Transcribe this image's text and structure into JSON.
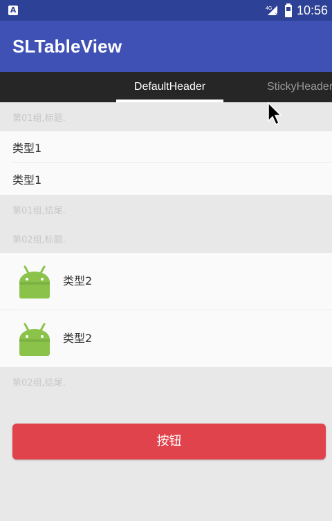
{
  "status_bar": {
    "network_label": "4G",
    "time": "10:56"
  },
  "app_bar": {
    "title": "SLTableView"
  },
  "tabs": [
    {
      "label": "DefaultHeader",
      "selected": true
    },
    {
      "label": "StickyHeader",
      "selected": false
    }
  ],
  "sections": [
    {
      "header": "第01组,标题.",
      "rows": [
        {
          "label": "类型1"
        },
        {
          "label": "类型1"
        }
      ],
      "footer": "第01组,结尾."
    },
    {
      "header": "第02组,标题.",
      "rows": [
        {
          "label": "类型2",
          "icon": "android-icon"
        },
        {
          "label": "类型2",
          "icon": "android-icon"
        }
      ],
      "footer": "第02组,结尾."
    }
  ],
  "action_button": {
    "label": "按钮"
  },
  "colors": {
    "status_bar": "#2d4196",
    "app_bar": "#3f51b5",
    "tab_bar": "#262626",
    "button": "#e0434b",
    "android_green": "#8bc34a"
  }
}
